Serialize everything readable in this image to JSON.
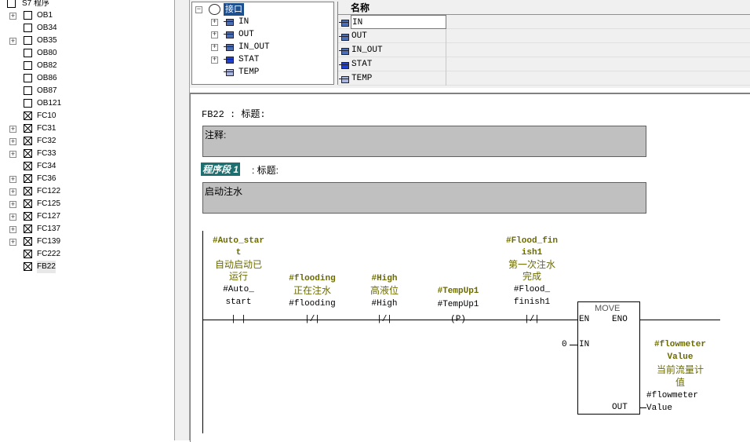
{
  "tree": {
    "root_label": "S7 程序",
    "items": [
      {
        "label": "OB1",
        "expandable": true,
        "crossed": false
      },
      {
        "label": "OB34",
        "expandable": false,
        "crossed": false
      },
      {
        "label": "OB35",
        "expandable": true,
        "crossed": false
      },
      {
        "label": "OB80",
        "expandable": false,
        "crossed": false
      },
      {
        "label": "OB82",
        "expandable": false,
        "crossed": false
      },
      {
        "label": "OB86",
        "expandable": false,
        "crossed": false
      },
      {
        "label": "OB87",
        "expandable": false,
        "crossed": false
      },
      {
        "label": "OB121",
        "expandable": false,
        "crossed": false
      },
      {
        "label": "FC10",
        "expandable": false,
        "crossed": true
      },
      {
        "label": "FC31",
        "expandable": true,
        "crossed": true
      },
      {
        "label": "FC32",
        "expandable": true,
        "crossed": true
      },
      {
        "label": "FC33",
        "expandable": true,
        "crossed": true
      },
      {
        "label": "FC34",
        "expandable": false,
        "crossed": true
      },
      {
        "label": "FC36",
        "expandable": true,
        "crossed": true
      },
      {
        "label": "FC122",
        "expandable": true,
        "crossed": true
      },
      {
        "label": "FC125",
        "expandable": true,
        "crossed": true
      },
      {
        "label": "FC127",
        "expandable": true,
        "crossed": true
      },
      {
        "label": "FC137",
        "expandable": true,
        "crossed": true
      },
      {
        "label": "FC139",
        "expandable": true,
        "crossed": true
      },
      {
        "label": "FC222",
        "expandable": false,
        "crossed": true
      },
      {
        "label": "FB22",
        "expandable": false,
        "crossed": true,
        "selected": true
      }
    ]
  },
  "interface": {
    "root_label": "接口",
    "tree_items": [
      "IN",
      "OUT",
      "IN_OUT",
      "STAT",
      "TEMP"
    ],
    "list_header": "名称",
    "list_items": [
      "IN",
      "OUT",
      "IN_OUT",
      "STAT",
      "TEMP"
    ]
  },
  "code": {
    "block_title": "FB22 : 标题:",
    "block_comment": "注释:",
    "network_label": "程序段 1",
    "network_title_suffix": ": 标题:",
    "network_comment": "启动注水"
  },
  "ladder": {
    "contacts": [
      {
        "sym1": "#Auto_star",
        "sym2": "t",
        "c1": "自动启动已",
        "c2": "运行",
        "o1": "#Auto_",
        "o2": "start",
        "glyph": "| |"
      },
      {
        "sym1": "#flooding",
        "c1": "正在注水",
        "o1": "#flooding",
        "glyph": "|/|"
      },
      {
        "sym1": "#High",
        "c1": "高液位",
        "o1": "#High",
        "glyph": "|/|"
      },
      {
        "sym1": "#TempUp1",
        "o1": "#TempUp1",
        "glyph": "(P)"
      },
      {
        "sym1": "#Flood_fin",
        "sym2": "ish1",
        "c1": "第一次注水",
        "c2": "完成",
        "o1": "#Flood_",
        "o2": "finish1",
        "glyph": "|/|"
      }
    ],
    "move": {
      "title": "MOVE",
      "en": "EN",
      "eno": "ENO",
      "in_pin": "IN",
      "in_value": "0",
      "out_pin": "OUT",
      "out_sym1": "#flowmeter",
      "out_sym2": "Value",
      "out_c1": "当前流量计",
      "out_c2": "值",
      "out_o1": "#flowmeter",
      "out_o2": "Value"
    }
  }
}
